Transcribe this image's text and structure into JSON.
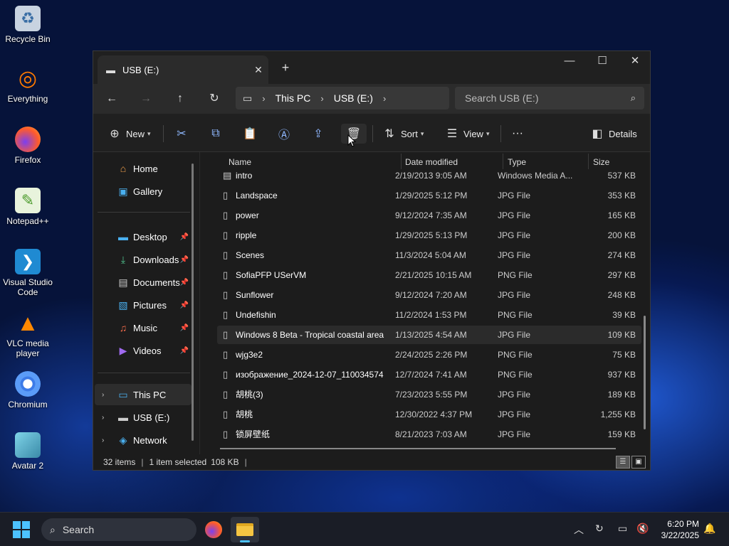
{
  "desktop": {
    "icons": [
      {
        "label": "Recycle Bin",
        "icon": "recycle-bin-icon"
      },
      {
        "label": "Everything",
        "icon": "everything-icon"
      },
      {
        "label": "Firefox",
        "icon": "firefox-icon"
      },
      {
        "label": "Notepad++",
        "icon": "notepadpp-icon"
      },
      {
        "label": "Visual Studio Code",
        "icon": "vscode-icon"
      },
      {
        "label": "VLC media player",
        "icon": "vlc-icon"
      },
      {
        "label": "Chromium",
        "icon": "chromium-icon"
      },
      {
        "label": "Avatar 2",
        "icon": "avatar-icon"
      }
    ]
  },
  "window": {
    "tab_title": "USB (E:)",
    "breadcrumb": [
      "This PC",
      "USB (E:)"
    ],
    "search_placeholder": "Search USB (E:)",
    "toolbar": {
      "new_label": "New",
      "sort_label": "Sort",
      "view_label": "View",
      "more_label": "···",
      "details_label": "Details"
    },
    "sidebar": {
      "items": [
        {
          "label": "Home",
          "icon": "home-icon"
        },
        {
          "label": "Gallery",
          "icon": "gallery-icon"
        },
        {
          "label": "Desktop",
          "icon": "desktop-icon",
          "pinned": true
        },
        {
          "label": "Downloads",
          "icon": "downloads-icon",
          "pinned": true
        },
        {
          "label": "Documents",
          "icon": "documents-icon",
          "pinned": true
        },
        {
          "label": "Pictures",
          "icon": "pictures-icon",
          "pinned": true
        },
        {
          "label": "Music",
          "icon": "music-icon",
          "pinned": true
        },
        {
          "label": "Videos",
          "icon": "videos-icon",
          "pinned": true
        },
        {
          "label": "This PC",
          "icon": "this-pc-icon"
        },
        {
          "label": "USB (E:)",
          "icon": "usb-drive-icon"
        },
        {
          "label": "Network",
          "icon": "network-icon"
        }
      ]
    },
    "columns": [
      "Name",
      "Date modified",
      "Type",
      "Size"
    ],
    "files": [
      {
        "name": "intro",
        "date": "2/19/2013 9:05 AM",
        "type": "Windows Media A...",
        "size": "537 KB"
      },
      {
        "name": "Landspace",
        "date": "1/29/2025 5:12 PM",
        "type": "JPG File",
        "size": "353 KB"
      },
      {
        "name": "power",
        "date": "9/12/2024 7:35 AM",
        "type": "JPG File",
        "size": "165 KB"
      },
      {
        "name": "ripple",
        "date": "1/29/2025 5:13 PM",
        "type": "JPG File",
        "size": "200 KB"
      },
      {
        "name": "Scenes",
        "date": "11/3/2024 5:04 AM",
        "type": "JPG File",
        "size": "274 KB"
      },
      {
        "name": "SofiaPFP USerVM",
        "date": "2/21/2025 10:15 AM",
        "type": "PNG File",
        "size": "297 KB"
      },
      {
        "name": "Sunflower",
        "date": "9/12/2024 7:20 AM",
        "type": "JPG File",
        "size": "248 KB"
      },
      {
        "name": "Undefishin",
        "date": "11/2/2024 1:53 PM",
        "type": "PNG File",
        "size": "39 KB"
      },
      {
        "name": "Windows 8 Beta - Tropical coastal area",
        "date": "1/13/2025 4:54 AM",
        "type": "JPG File",
        "size": "109 KB"
      },
      {
        "name": "wjg3e2",
        "date": "2/24/2025 2:26 PM",
        "type": "PNG File",
        "size": "75 KB"
      },
      {
        "name": "изображение_2024-12-07_110034574",
        "date": "12/7/2024 7:41 AM",
        "type": "PNG File",
        "size": "937 KB"
      },
      {
        "name": "胡桃(3)",
        "date": "7/23/2023 5:55 PM",
        "type": "JPG File",
        "size": "189 KB"
      },
      {
        "name": "胡桃",
        "date": "12/30/2022 4:37 PM",
        "type": "JPG File",
        "size": "1,255 KB"
      },
      {
        "name": "锁屏壁纸",
        "date": "8/21/2023 7:03 AM",
        "type": "JPG File",
        "size": "159 KB"
      }
    ],
    "selected_file": "Windows 8 Beta - Tropical coastal area",
    "status": {
      "count": "32 items",
      "selection": "1 item selected",
      "size": "108 KB"
    }
  },
  "taskbar": {
    "search_label": "Search",
    "time": "6:20 PM",
    "date": "3/22/2025"
  }
}
